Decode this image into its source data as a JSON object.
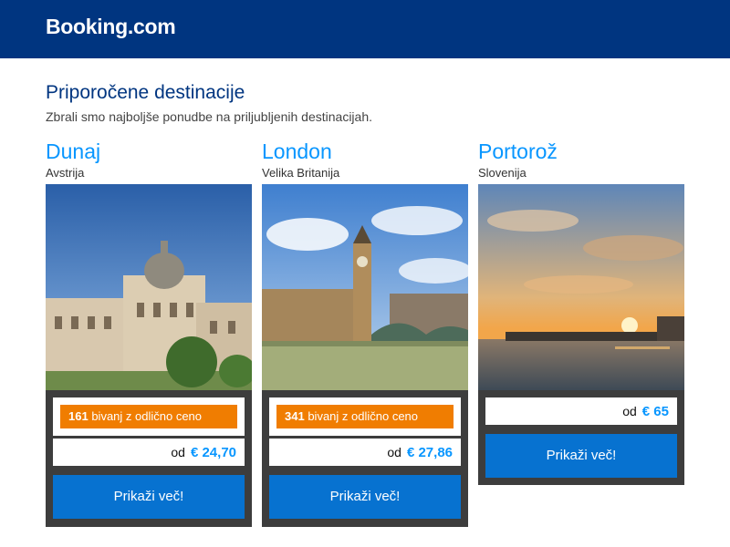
{
  "header": {
    "logo_text": "Booking.com",
    "bg_color": "#003580"
  },
  "section": {
    "title": "Priporočene destinacije",
    "subtitle": "Zbrali smo najboljše ponudbe na priljubljenih destinacijah."
  },
  "destinations": [
    {
      "name": "Dunaj",
      "country": "Avstrija",
      "deals_count": "161",
      "deals_text": "bivanj z odlično ceno",
      "price_prefix": "od",
      "price": "€ 24,70",
      "button_label": "Prikaži več!"
    },
    {
      "name": "London",
      "country": "Velika Britanija",
      "deals_count": "341",
      "deals_text": "bivanj z odlično ceno",
      "price_prefix": "od",
      "price": "€ 27,86",
      "button_label": "Prikaži več!"
    },
    {
      "name": "Portorož",
      "country": "Slovenija",
      "price_prefix": "od",
      "price": "€ 65",
      "button_label": "Prikaži več!"
    }
  ],
  "colors": {
    "accent_blue": "#0896ff",
    "button_blue": "#0772d0",
    "deal_orange": "#f07d01",
    "panel_gray": "#3d3d3d"
  }
}
